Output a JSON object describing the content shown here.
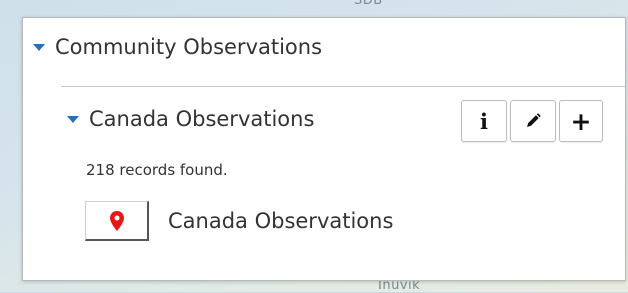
{
  "map": {
    "label_top": "SDB",
    "label_bottom": "Inuvik"
  },
  "panel": {
    "section_title": "Community Observations",
    "layer": {
      "title": "Canada Observations",
      "records_text": "218 records found.",
      "legend_label": "Canada Observations"
    },
    "tools": [
      {
        "icon": "info-icon",
        "glyph": "i"
      },
      {
        "icon": "pencil-icon"
      },
      {
        "icon": "plus-icon",
        "glyph": "+"
      }
    ]
  },
  "colors": {
    "caret": "#2f6db3",
    "marker": "#e81717"
  }
}
